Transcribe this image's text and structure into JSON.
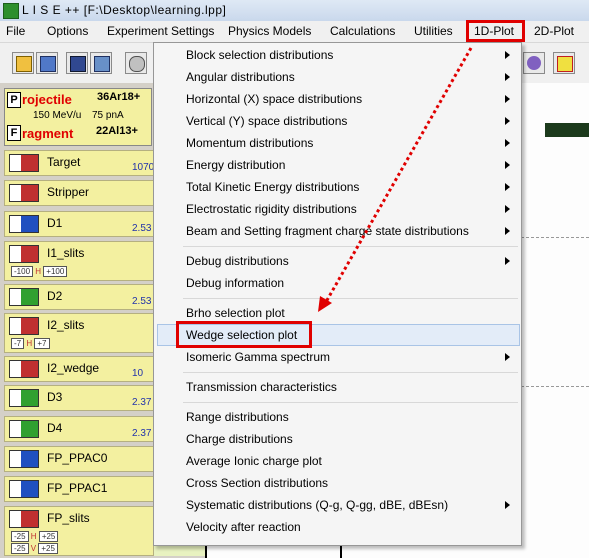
{
  "window": {
    "title": "L I S E ++  [F:\\Desktop\\learning.lpp]"
  },
  "menubar": {
    "items": [
      "File",
      "Options",
      "Experiment Settings",
      "Physics Models",
      "Calculations",
      "Utilities",
      "1D-Plot",
      "2D-Plot"
    ]
  },
  "projectile": {
    "label": "rojectile",
    "isotope": "36Ar18+",
    "energy": "150 MeV/u",
    "intensity": "75 pnA"
  },
  "fragment": {
    "label": "ragment",
    "isotope": "22Al13+"
  },
  "blocks": [
    {
      "label": "Target",
      "value": "1070"
    },
    {
      "label": "Stripper",
      "value": ""
    },
    {
      "label": "D1",
      "value": "2.53"
    },
    {
      "label": "I1_slits",
      "value": "",
      "slit": [
        "-100",
        "H",
        "+100"
      ]
    },
    {
      "label": "D2",
      "value": "2.53"
    },
    {
      "label": "I2_slits",
      "value": "",
      "slit": [
        "-7",
        "H",
        "+7"
      ]
    },
    {
      "label": "I2_wedge",
      "value": "10"
    },
    {
      "label": "D3",
      "value": "2.37"
    },
    {
      "label": "D4",
      "value": "2.37"
    },
    {
      "label": "FP_PPAC0",
      "value": ""
    },
    {
      "label": "FP_PPAC1",
      "value": ""
    },
    {
      "label": "FP_slits",
      "value": "",
      "slit": [
        "-25",
        "H",
        "+25"
      ],
      "slit2": [
        "-25",
        "V",
        "+25"
      ]
    }
  ],
  "dropdown": {
    "items": [
      "Block selection distributions",
      "Angular distributions",
      "Horizontal (X) space  distributions",
      "Vertical (Y) space  distributions",
      "Momentum distributions",
      "Energy distribution",
      "Total Kinetic Energy distributions",
      "Electrostatic rigidity distributions",
      "Beam and Setting fragment charge state distributions",
      "Debug distributions",
      "Debug information",
      "Brho selection plot",
      "Wedge selection plot",
      "Isomeric Gamma spectrum",
      "Transmission characteristics",
      "Range distributions",
      "Charge distributions",
      "Average Ionic charge plot",
      "Cross Section distributions",
      "Systematic distributions (Q-g, Q-gg, dBE, dBEsn)",
      "Velocity after reaction"
    ]
  },
  "colors": {
    "highlight": "#e00000",
    "panel": "#f3f0a0",
    "value": "#2233aa"
  }
}
